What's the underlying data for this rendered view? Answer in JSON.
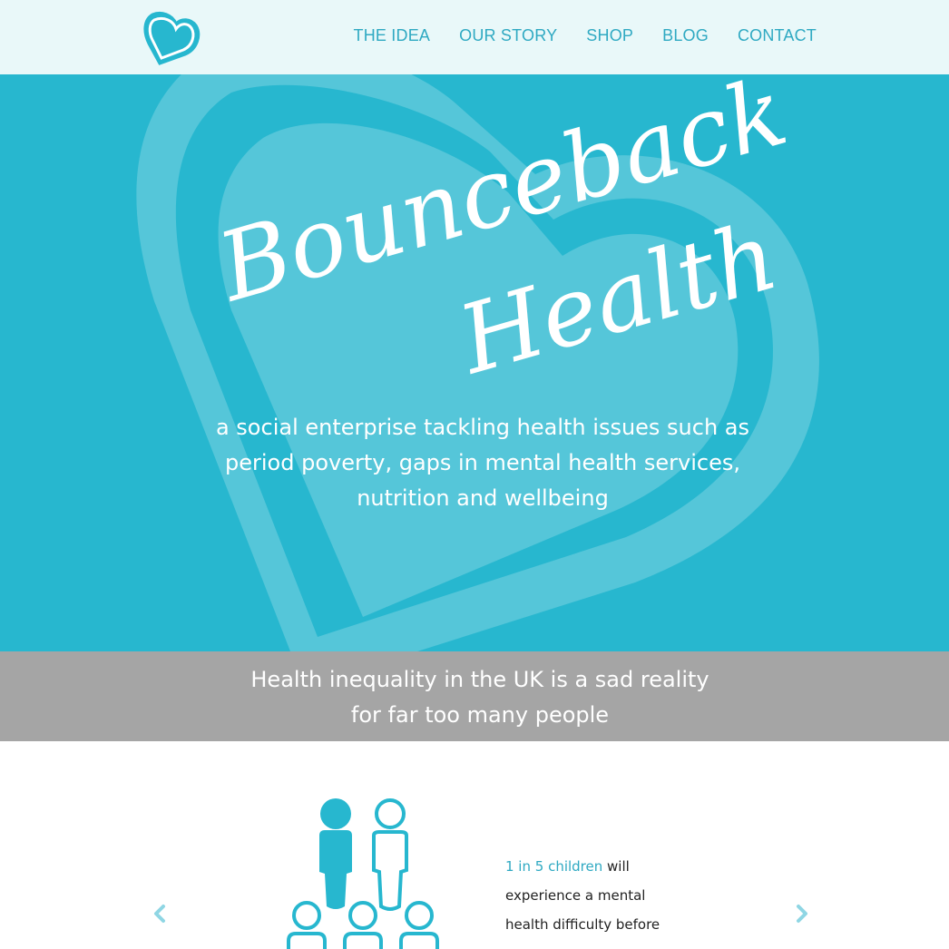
{
  "nav": {
    "items": [
      {
        "label": "THE IDEA"
      },
      {
        "label": "OUR STORY"
      },
      {
        "label": "SHOP"
      },
      {
        "label": "BLOG"
      },
      {
        "label": "CONTACT"
      }
    ]
  },
  "hero": {
    "title_line1": "Bounceback",
    "title_line2": "Health",
    "tagline": "a social enterprise tackling health issues such as period poverty, gaps in mental health services, nutrition and wellbeing"
  },
  "band": {
    "text": "Health inequality in the UK is a sad reality for far too many people"
  },
  "carousel": {
    "stat_highlight": "1 in 5 children",
    "stat_text": " will experience a mental health difficulty before"
  },
  "colors": {
    "accent": "#27b7cf",
    "nav_text": "#2fa9c2",
    "header_bg": "#e9f8f9",
    "band_bg": "#a5a5a5"
  },
  "icons": {
    "logo": "heart-logo-icon",
    "prev": "chevron-left-icon",
    "next": "chevron-right-icon",
    "people": "people-group-icon"
  }
}
